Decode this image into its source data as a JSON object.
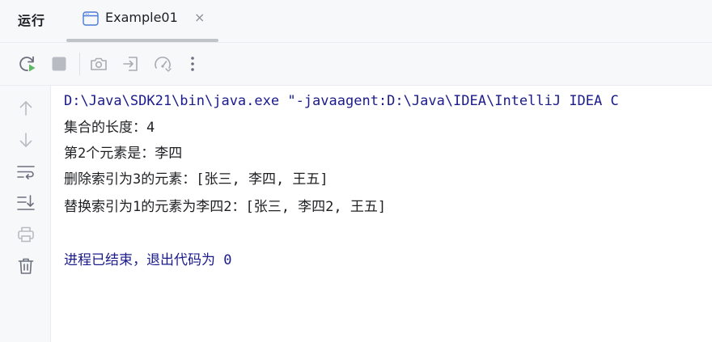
{
  "header": {
    "run_title": "运行",
    "tab": {
      "label": "Example01",
      "close_glyph": "×"
    }
  },
  "toolbar": {
    "buttons": [
      "rerun-icon",
      "stop-icon",
      "screenshot-icon",
      "login-icon",
      "profiler-icon",
      "more-options-icon"
    ]
  },
  "gutter": {
    "buttons": [
      "arrow-up-icon",
      "arrow-down-icon",
      "soft-wrap-icon",
      "scroll-to-end-icon",
      "print-icon",
      "trash-icon"
    ]
  },
  "console": {
    "command": "D:\\Java\\SDK21\\bin\\java.exe \"-javaagent:D:\\Java\\IDEA\\IntelliJ IDEA C",
    "lines": [
      "集合的长度：4",
      "第2个元素是：李四",
      "删除索引为3的元素：[张三, 李四, 王五]",
      "替换索引为1的元素为李四2：[张三, 李四2, 王五]"
    ],
    "exit_message": "进程已结束，退出代码为 0"
  },
  "colors": {
    "command_text": "#1a1a8c",
    "output_text": "#1e1f22",
    "background": "#f7f8fa",
    "console_background": "#ffffff"
  }
}
